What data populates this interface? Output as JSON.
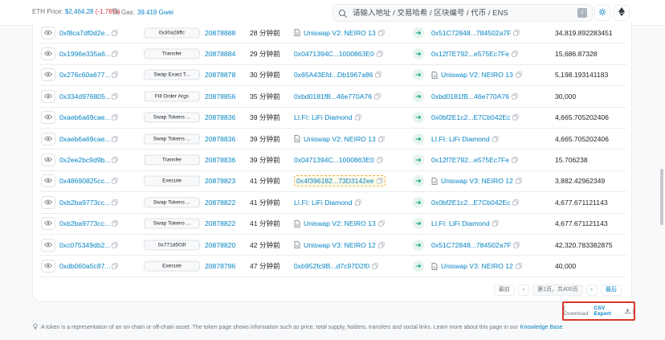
{
  "header": {
    "eth_price_label": "ETH Price:",
    "eth_price_value": "$2,464.28",
    "eth_price_change": "(-1.78%)",
    "gas_label": "Gas:",
    "gas_value": "39.419 Gwei",
    "search_placeholder": "请输入地址 / 交易哈希 / 区块编号 / 代币 / ENS",
    "search_kbd": "/"
  },
  "rows": [
    {
      "hash": "0xf8ca7df0d2e...",
      "method": "0x30a28ffc",
      "block": "20878888",
      "age": "28 分钟前",
      "from": "Uniswap V2: NEIRO 13",
      "from_type": "contract",
      "to": "0x51C72848...784502a7F",
      "to_type": "plain",
      "qty": "34,819.892283451"
    },
    {
      "hash": "0x1996e335a6...",
      "method": "Transfer",
      "block": "20878884",
      "age": "29 分钟前",
      "from": "0x0471394C...1000863E0",
      "from_type": "plain",
      "to": "0x12f7E792...e575Ec7Fe",
      "to_type": "plain",
      "qty": "15,686.87328"
    },
    {
      "hash": "0x276c60a677...",
      "method": "Swap Exact T...",
      "block": "20878878",
      "age": "30 分钟前",
      "from": "0x65A43Efd...Db1967a86",
      "from_type": "plain",
      "to": "Uniswap V2: NEIRO 13",
      "to_type": "contract",
      "qty": "5,198.193141183"
    },
    {
      "hash": "0x334d976805...",
      "method": "Fill Order Args",
      "block": "20878856",
      "age": "35 分钟前",
      "from": "0xbd0181fB...46e770A76",
      "from_type": "plain",
      "to": "0xbd0181fB...46e770A76",
      "to_type": "plain",
      "qty": "30,000"
    },
    {
      "hash": "0xaeb6a69cae...",
      "method": "Swap Tokens ...",
      "block": "20878836",
      "age": "39 分钟前",
      "from": "LI.FI: LiFi Diamond",
      "from_type": "plain",
      "to": "0x0bf2E1c2...E7Cb042Ec",
      "to_type": "plain",
      "qty": "4,665.705202406"
    },
    {
      "hash": "0xaeb6a69cae...",
      "method": "Swap Tokens ...",
      "block": "20878836",
      "age": "39 分钟前",
      "from": "Uniswap V2: NEIRO 13",
      "from_type": "contract",
      "to": "LI.FI: LiFi Diamond",
      "to_type": "plain",
      "qty": "4,665.705202406"
    },
    {
      "hash": "0x2ee2bc9d9b...",
      "method": "Transfer",
      "block": "20878836",
      "age": "39 分钟前",
      "from": "0x0471394C...1000863E0",
      "from_type": "plain",
      "to": "0x12f7E792...e575Ec7Fe",
      "to_type": "plain",
      "qty": "15.706238"
    },
    {
      "hash": "0x48690825cc...",
      "method": "Execute",
      "block": "20878823",
      "age": "41 分钟前",
      "from": "0x4f396182...73D3142ee",
      "from_type": "highlight",
      "to": "Uniswap V3: NEIRO 12",
      "to_type": "contract",
      "qty": "3,882.42962349"
    },
    {
      "hash": "0xb2ba9773cc...",
      "method": "Swap Tokens ...",
      "block": "20878822",
      "age": "41 分钟前",
      "from": "LI.FI: LiFi Diamond",
      "from_type": "plain",
      "to": "0x0bf2E1c2...E7Cb042Ec",
      "to_type": "plain",
      "qty": "4,677.671121143"
    },
    {
      "hash": "0xb2ba9773cc...",
      "method": "Swap Tokens ...",
      "block": "20878822",
      "age": "41 分钟前",
      "from": "Uniswap V2: NEIRO 13",
      "from_type": "contract",
      "to": "LI.FI: LiFi Diamond",
      "to_type": "plain",
      "qty": "4,677.671121143"
    },
    {
      "hash": "0xc075349db2...",
      "method": "0x771d503f",
      "block": "20878820",
      "age": "42 分钟前",
      "from": "Uniswap V3: NEIRO 12",
      "from_type": "contract",
      "to": "0x51C72848...784502a7F",
      "to_type": "plain",
      "qty": "42,320.783382875"
    },
    {
      "hash": "0xdb060a5c87...",
      "method": "Execute",
      "block": "20878796",
      "age": "47 分钟前",
      "from": "0xb952fc9B...d7c97D2f0",
      "from_type": "plain",
      "to": "Uniswap V3: NEIRO 12",
      "to_type": "contract",
      "qty": "40,000"
    }
  ],
  "pagination": {
    "first": "最前",
    "prev": "‹",
    "info": "第1页，共400页",
    "next": "›",
    "last": "最后"
  },
  "download": {
    "prefix": "[ Download:",
    "link": "CSV Export",
    "suffix": "]"
  },
  "footer": {
    "text": "A token is a representation of an on-chain or off-chain asset. The token page shows information such as price, total supply, holders, transfers and social links. Learn more about this page in our",
    "link": "Knowledge Base",
    "end": "."
  },
  "colors": {
    "link": "#0784c3",
    "negative": "#dc3545",
    "highlight_border": "#d9382b",
    "arrow_bg": "#e6f4ec",
    "arrow_fg": "#00a186"
  }
}
